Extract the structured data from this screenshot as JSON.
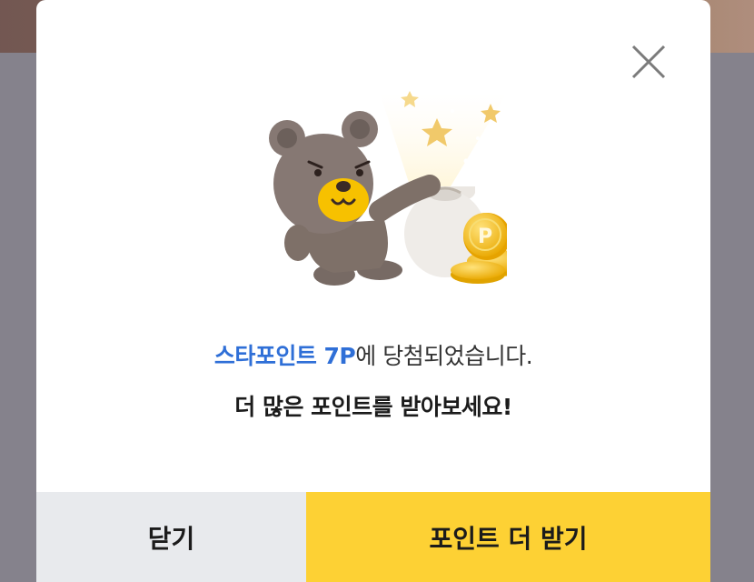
{
  "modal": {
    "message_highlight": "스타포인트 7P",
    "message_rest": "에 당첨되었습니다.",
    "sub_message": "더 많은 포인트를 받아보세요!",
    "close_label": "닫기",
    "more_label": "포인트 더 받기",
    "coin_letter": "P"
  },
  "icons": {
    "close": "close-icon",
    "illustration": "bear-with-point-bag-illustration"
  },
  "colors": {
    "highlight": "#2f6fd7",
    "primary_button": "#fdd134",
    "secondary_button": "#e8eaed"
  }
}
